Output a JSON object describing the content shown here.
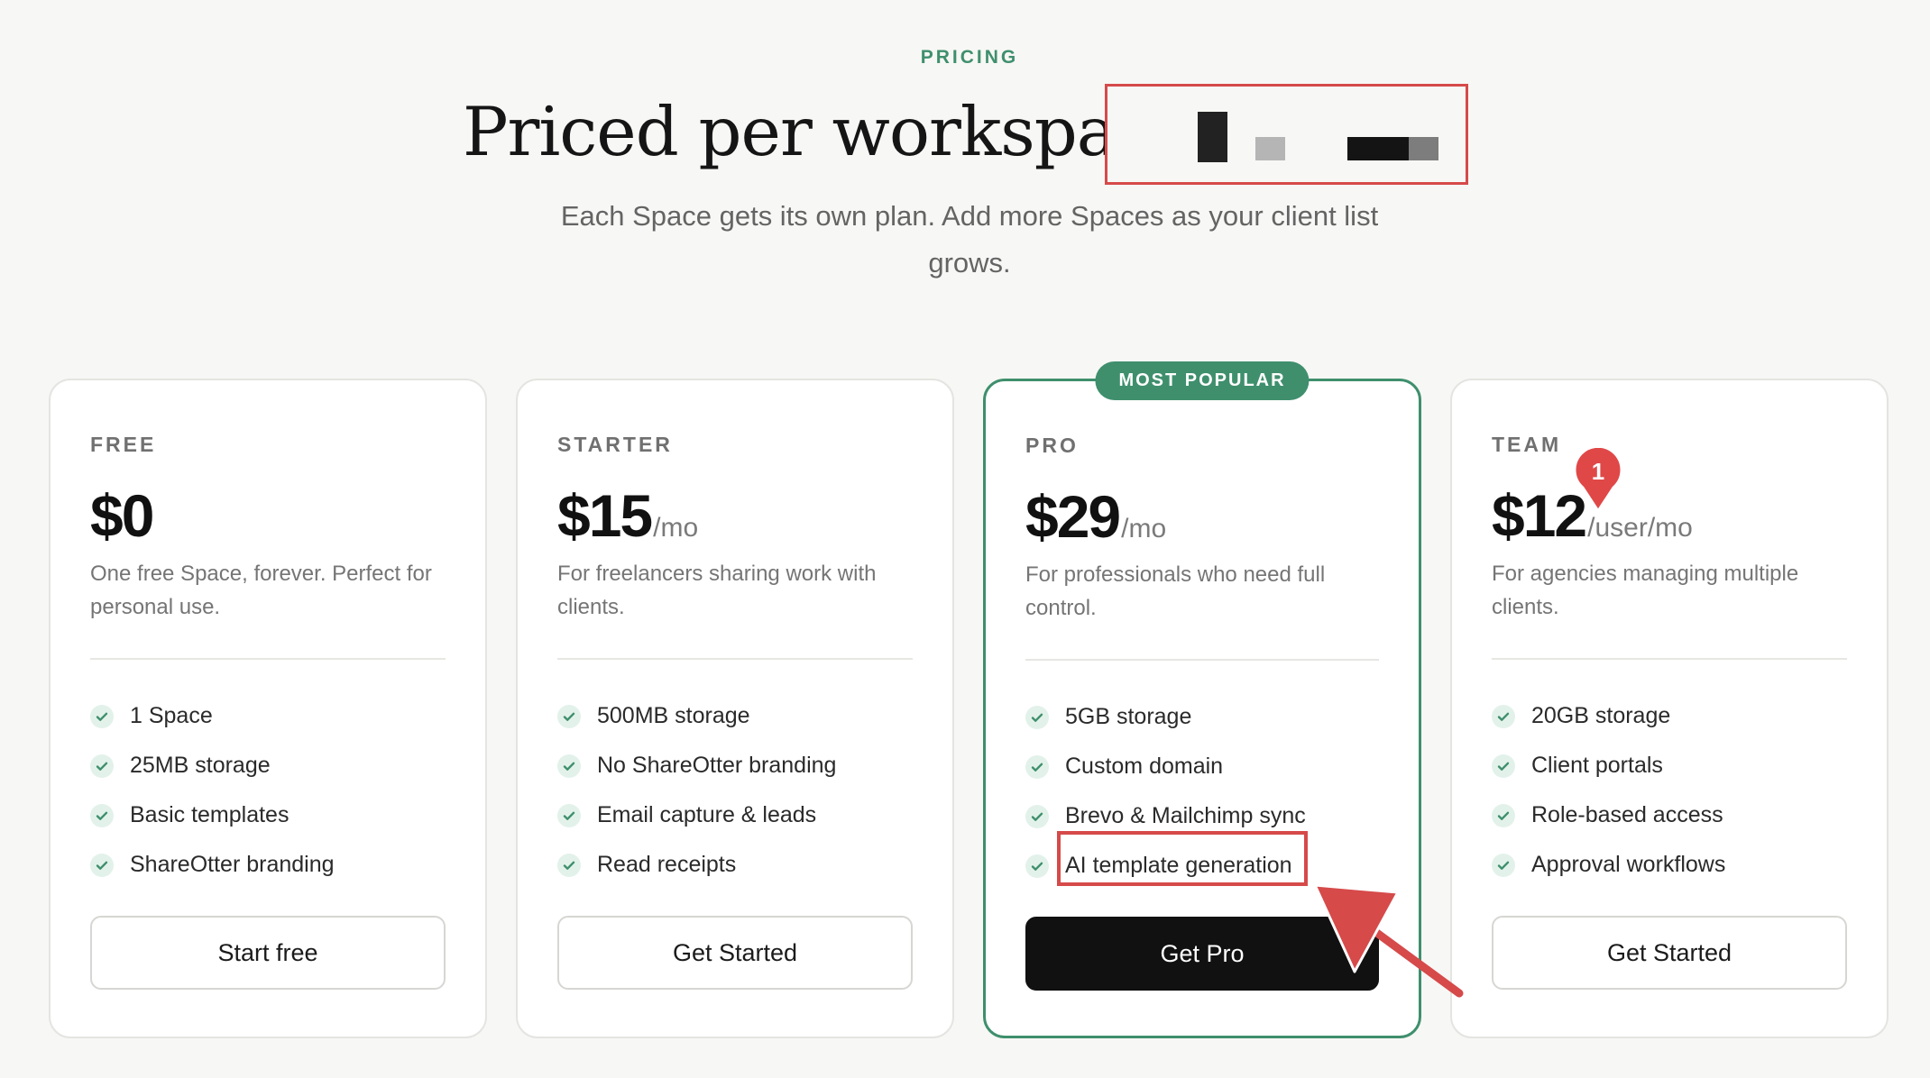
{
  "section": {
    "eyebrow": "PRICING",
    "headline": "Priced per workspace,",
    "subtitle": "Each Space gets its own plan. Add more Spaces as your client list grows."
  },
  "colors": {
    "accent": "#3f8f6d",
    "annotation": "#d64a4a",
    "dark_button": "#111111"
  },
  "plans": [
    {
      "tier": "FREE",
      "price": "$0",
      "period": "",
      "description": "One free Space, forever. Perfect for personal use.",
      "features": [
        "1 Space",
        "25MB storage",
        "Basic templates",
        "ShareOtter branding"
      ],
      "cta": "Start free"
    },
    {
      "tier": "STARTER",
      "price": "$15",
      "period": "/mo",
      "description": "For freelancers sharing work with clients.",
      "features": [
        "500MB storage",
        "No ShareOtter branding",
        "Email capture & leads",
        "Read receipts"
      ],
      "cta": "Get Started"
    },
    {
      "tier": "PRO",
      "badge": "MOST POPULAR",
      "price": "$29",
      "period": "/mo",
      "description": "For professionals who need full control.",
      "features": [
        "5GB storage",
        "Custom domain",
        "Brevo & Mailchimp sync",
        "AI template generation"
      ],
      "cta": "Get Pro"
    },
    {
      "tier": "TEAM",
      "price": "$12",
      "period": "/user/mo",
      "description": "For agencies managing multiple clients.",
      "features": [
        "20GB storage",
        "Client portals",
        "Role-based access",
        "Approval workflows"
      ],
      "cta": "Get Started"
    }
  ],
  "annotations": {
    "marker_number": "1",
    "icons": [
      "check-icon",
      "arrow-pointer",
      "pin-marker",
      "redaction-block"
    ]
  }
}
